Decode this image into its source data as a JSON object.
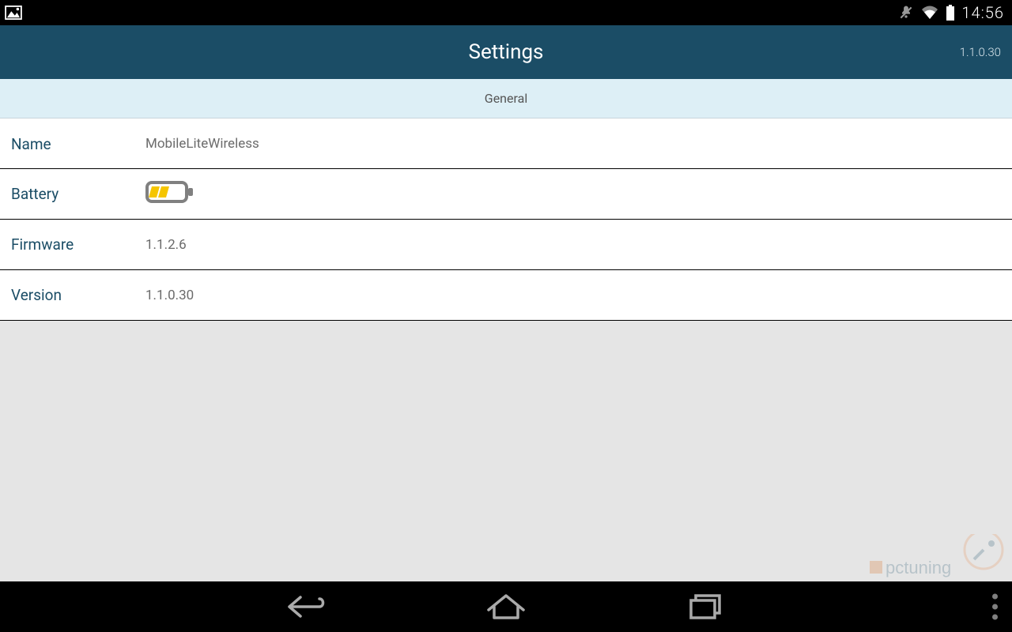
{
  "statusbar": {
    "clock": "14:56"
  },
  "header": {
    "title": "Settings",
    "version": "1.1.0.30"
  },
  "section": {
    "label": "General"
  },
  "rows": {
    "name": {
      "label": "Name",
      "value": "MobileLiteWireless"
    },
    "battery": {
      "label": "Battery"
    },
    "firmware": {
      "label": "Firmware",
      "value": "1.1.2.6"
    },
    "version": {
      "label": "Version",
      "value": "1.1.0.30"
    }
  },
  "watermark": {
    "text": "pctuning"
  }
}
